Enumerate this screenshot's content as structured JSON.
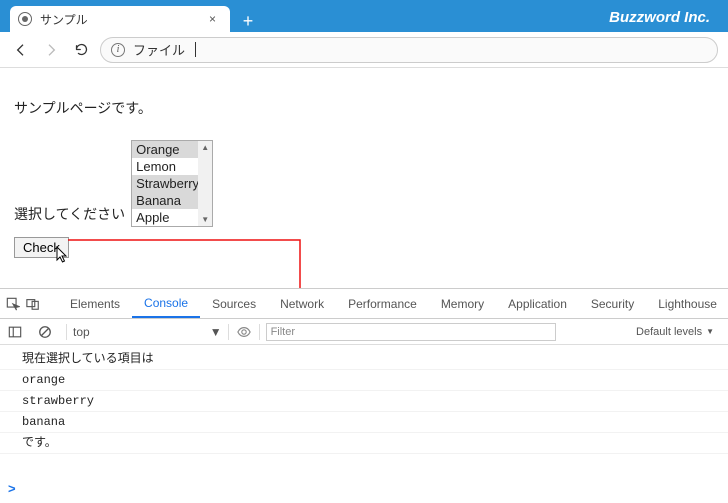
{
  "brand": "Buzzword Inc.",
  "tab": {
    "title": "サンプル"
  },
  "address": {
    "info_glyph": "i",
    "text": "ファイル"
  },
  "page": {
    "heading": "サンプルページです。",
    "label": "選択してください",
    "options": [
      "Orange",
      "Lemon",
      "Strawberry",
      "Banana",
      "Apple"
    ],
    "selected_indices": [
      0,
      2,
      3
    ],
    "button": "Check"
  },
  "devtools": {
    "tabs": [
      "Elements",
      "Console",
      "Sources",
      "Network",
      "Performance",
      "Memory",
      "Application",
      "Security",
      "Lighthouse"
    ],
    "active_tab": "Console",
    "context": "top",
    "filter_placeholder": "Filter",
    "levels": "Default levels",
    "console_lines": [
      "現在選択している項目は",
      "orange",
      "strawberry",
      "banana",
      "です。"
    ],
    "prompt": ">"
  }
}
